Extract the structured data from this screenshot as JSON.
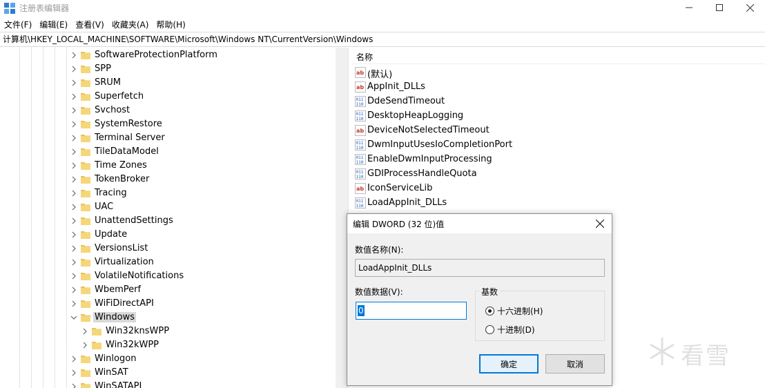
{
  "window": {
    "title": "注册表编辑器"
  },
  "menu": [
    "文件(F)",
    "编辑(E)",
    "查看(V)",
    "收藏夹(A)",
    "帮助(H)"
  ],
  "address": "计算机\\HKEY_LOCAL_MACHINE\\SOFTWARE\\Microsoft\\Windows NT\\CurrentVersion\\Windows",
  "tree": {
    "items": [
      "SoftwareProtectionPlatform",
      "SPP",
      "SRUM",
      "Superfetch",
      "Svchost",
      "SystemRestore",
      "Terminal Server",
      "TileDataModel",
      "Time Zones",
      "TokenBroker",
      "Tracing",
      "UAC",
      "UnattendSettings",
      "Update",
      "VersionsList",
      "Virtualization",
      "VolatileNotifications",
      "WbemPerf",
      "WiFiDirectAPI",
      "Windows",
      "Win32knsWPP",
      "Win32kWPP",
      "Winlogon",
      "WinSAT",
      "WinSATAPI"
    ],
    "selected": "Windows"
  },
  "values": {
    "column_name": "名称",
    "items": [
      {
        "name": "(默认)",
        "type": "string"
      },
      {
        "name": "AppInit_DLLs",
        "type": "string"
      },
      {
        "name": "DdeSendTimeout",
        "type": "dword"
      },
      {
        "name": "DesktopHeapLogging",
        "type": "dword"
      },
      {
        "name": "DeviceNotSelectedTimeout",
        "type": "string"
      },
      {
        "name": "DwmInputUsesIoCompletionPort",
        "type": "dword"
      },
      {
        "name": "EnableDwmInputProcessing",
        "type": "dword"
      },
      {
        "name": "GDIProcessHandleQuota",
        "type": "dword"
      },
      {
        "name": "IconServiceLib",
        "type": "string"
      },
      {
        "name": "LoadAppInit_DLLs",
        "type": "dword"
      }
    ]
  },
  "dialog": {
    "title": "编辑 DWORD (32 位)值",
    "name_label": "数值名称(N):",
    "name_value": "LoadAppInit_DLLs",
    "data_label": "数值数据(V):",
    "data_value": "0",
    "base_label": "基数",
    "radio_hex": "十六进制(H)",
    "radio_dec": "十进制(D)",
    "base_selected": "hex",
    "ok": "确定",
    "cancel": "取消"
  },
  "watermark": {
    "text": "看雪"
  },
  "colors": {
    "accent": "#0078d7",
    "folder": "#e8c15a",
    "string_icon": "#c0392b",
    "dword_icon": "#1f5fbf"
  }
}
